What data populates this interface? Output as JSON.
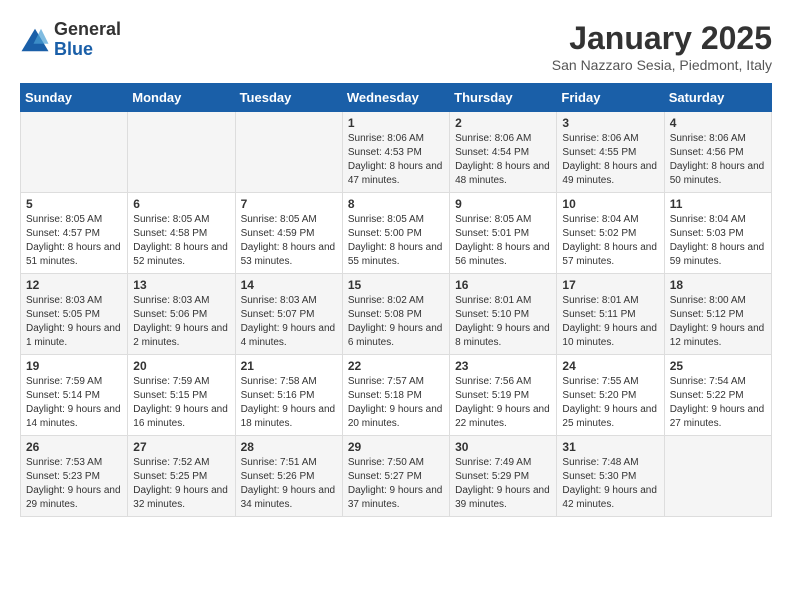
{
  "header": {
    "logo_general": "General",
    "logo_blue": "Blue",
    "title": "January 2025",
    "subtitle": "San Nazzaro Sesia, Piedmont, Italy"
  },
  "days_of_week": [
    "Sunday",
    "Monday",
    "Tuesday",
    "Wednesday",
    "Thursday",
    "Friday",
    "Saturday"
  ],
  "weeks": [
    [
      {
        "day": "",
        "info": ""
      },
      {
        "day": "",
        "info": ""
      },
      {
        "day": "",
        "info": ""
      },
      {
        "day": "1",
        "info": "Sunrise: 8:06 AM\nSunset: 4:53 PM\nDaylight: 8 hours and 47 minutes."
      },
      {
        "day": "2",
        "info": "Sunrise: 8:06 AM\nSunset: 4:54 PM\nDaylight: 8 hours and 48 minutes."
      },
      {
        "day": "3",
        "info": "Sunrise: 8:06 AM\nSunset: 4:55 PM\nDaylight: 8 hours and 49 minutes."
      },
      {
        "day": "4",
        "info": "Sunrise: 8:06 AM\nSunset: 4:56 PM\nDaylight: 8 hours and 50 minutes."
      }
    ],
    [
      {
        "day": "5",
        "info": "Sunrise: 8:05 AM\nSunset: 4:57 PM\nDaylight: 8 hours and 51 minutes."
      },
      {
        "day": "6",
        "info": "Sunrise: 8:05 AM\nSunset: 4:58 PM\nDaylight: 8 hours and 52 minutes."
      },
      {
        "day": "7",
        "info": "Sunrise: 8:05 AM\nSunset: 4:59 PM\nDaylight: 8 hours and 53 minutes."
      },
      {
        "day": "8",
        "info": "Sunrise: 8:05 AM\nSunset: 5:00 PM\nDaylight: 8 hours and 55 minutes."
      },
      {
        "day": "9",
        "info": "Sunrise: 8:05 AM\nSunset: 5:01 PM\nDaylight: 8 hours and 56 minutes."
      },
      {
        "day": "10",
        "info": "Sunrise: 8:04 AM\nSunset: 5:02 PM\nDaylight: 8 hours and 57 minutes."
      },
      {
        "day": "11",
        "info": "Sunrise: 8:04 AM\nSunset: 5:03 PM\nDaylight: 8 hours and 59 minutes."
      }
    ],
    [
      {
        "day": "12",
        "info": "Sunrise: 8:03 AM\nSunset: 5:05 PM\nDaylight: 9 hours and 1 minute."
      },
      {
        "day": "13",
        "info": "Sunrise: 8:03 AM\nSunset: 5:06 PM\nDaylight: 9 hours and 2 minutes."
      },
      {
        "day": "14",
        "info": "Sunrise: 8:03 AM\nSunset: 5:07 PM\nDaylight: 9 hours and 4 minutes."
      },
      {
        "day": "15",
        "info": "Sunrise: 8:02 AM\nSunset: 5:08 PM\nDaylight: 9 hours and 6 minutes."
      },
      {
        "day": "16",
        "info": "Sunrise: 8:01 AM\nSunset: 5:10 PM\nDaylight: 9 hours and 8 minutes."
      },
      {
        "day": "17",
        "info": "Sunrise: 8:01 AM\nSunset: 5:11 PM\nDaylight: 9 hours and 10 minutes."
      },
      {
        "day": "18",
        "info": "Sunrise: 8:00 AM\nSunset: 5:12 PM\nDaylight: 9 hours and 12 minutes."
      }
    ],
    [
      {
        "day": "19",
        "info": "Sunrise: 7:59 AM\nSunset: 5:14 PM\nDaylight: 9 hours and 14 minutes."
      },
      {
        "day": "20",
        "info": "Sunrise: 7:59 AM\nSunset: 5:15 PM\nDaylight: 9 hours and 16 minutes."
      },
      {
        "day": "21",
        "info": "Sunrise: 7:58 AM\nSunset: 5:16 PM\nDaylight: 9 hours and 18 minutes."
      },
      {
        "day": "22",
        "info": "Sunrise: 7:57 AM\nSunset: 5:18 PM\nDaylight: 9 hours and 20 minutes."
      },
      {
        "day": "23",
        "info": "Sunrise: 7:56 AM\nSunset: 5:19 PM\nDaylight: 9 hours and 22 minutes."
      },
      {
        "day": "24",
        "info": "Sunrise: 7:55 AM\nSunset: 5:20 PM\nDaylight: 9 hours and 25 minutes."
      },
      {
        "day": "25",
        "info": "Sunrise: 7:54 AM\nSunset: 5:22 PM\nDaylight: 9 hours and 27 minutes."
      }
    ],
    [
      {
        "day": "26",
        "info": "Sunrise: 7:53 AM\nSunset: 5:23 PM\nDaylight: 9 hours and 29 minutes."
      },
      {
        "day": "27",
        "info": "Sunrise: 7:52 AM\nSunset: 5:25 PM\nDaylight: 9 hours and 32 minutes."
      },
      {
        "day": "28",
        "info": "Sunrise: 7:51 AM\nSunset: 5:26 PM\nDaylight: 9 hours and 34 minutes."
      },
      {
        "day": "29",
        "info": "Sunrise: 7:50 AM\nSunset: 5:27 PM\nDaylight: 9 hours and 37 minutes."
      },
      {
        "day": "30",
        "info": "Sunrise: 7:49 AM\nSunset: 5:29 PM\nDaylight: 9 hours and 39 minutes."
      },
      {
        "day": "31",
        "info": "Sunrise: 7:48 AM\nSunset: 5:30 PM\nDaylight: 9 hours and 42 minutes."
      },
      {
        "day": "",
        "info": ""
      }
    ]
  ]
}
